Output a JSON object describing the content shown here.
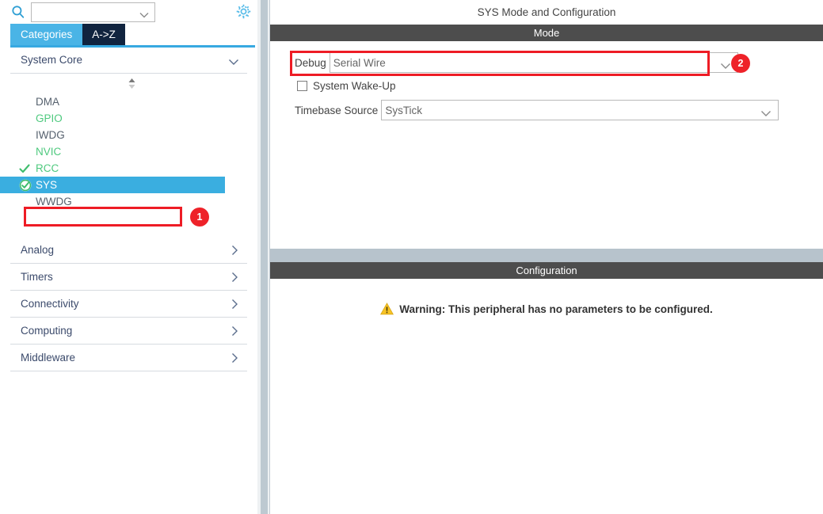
{
  "sidebar": {
    "search": {
      "value": "",
      "placeholder": "",
      "icon": "search-icon"
    },
    "gear_icon": "gear-icon",
    "tabs": [
      {
        "label": "Categories",
        "selected": true
      },
      {
        "label": "A->Z",
        "selected": false
      }
    ],
    "expanded_category": {
      "label": "System Core",
      "chevron": "chevron-down-icon",
      "sort_icon": "sort-arrows-icon",
      "items": [
        {
          "label": "DMA",
          "state": "gray",
          "check": false,
          "selected": false
        },
        {
          "label": "GPIO",
          "state": "green",
          "check": false,
          "selected": false
        },
        {
          "label": "IWDG",
          "state": "gray",
          "check": false,
          "selected": false
        },
        {
          "label": "NVIC",
          "state": "green",
          "check": false,
          "selected": false
        },
        {
          "label": "RCC",
          "state": "green",
          "check": true,
          "selected": false
        },
        {
          "label": "SYS",
          "state": "selected",
          "check": true,
          "selected": true
        },
        {
          "label": "WWDG",
          "state": "gray",
          "check": false,
          "selected": false
        }
      ]
    },
    "collapsed_categories": [
      {
        "label": "Analog",
        "chevron": "chevron-right-icon"
      },
      {
        "label": "Timers",
        "chevron": "chevron-right-icon"
      },
      {
        "label": "Connectivity",
        "chevron": "chevron-right-icon"
      },
      {
        "label": "Computing",
        "chevron": "chevron-right-icon"
      },
      {
        "label": "Middleware",
        "chevron": "chevron-right-icon"
      }
    ]
  },
  "main": {
    "title": "SYS Mode and Configuration",
    "mode_section": {
      "title": "Mode"
    },
    "debug": {
      "label": "Debug",
      "value": "Serial Wire",
      "chevron": "chevron-down-icon"
    },
    "wakeup": {
      "label": "System Wake-Up",
      "checked": false
    },
    "timebase": {
      "label": "Timebase Source",
      "value": "SysTick",
      "chevron": "chevron-down-icon"
    },
    "config_section": {
      "title": "Configuration"
    },
    "warning": {
      "icon": "warning-triangle-icon",
      "text": "Warning: This peripheral has no parameters to be configured."
    }
  },
  "annotations": [
    {
      "id": "1",
      "label": "1"
    },
    {
      "id": "2",
      "label": "2"
    }
  ],
  "colors": {
    "accent_blue": "#3aaee0",
    "tab_selected": "#4ab4e6",
    "tab_alt": "#11243f",
    "green": "#4ec97e",
    "section_bar": "#4d4d4d",
    "annotation_red": "#ee2229",
    "warning_yellow": "#f7c325",
    "divider": "#bdc9d1"
  }
}
